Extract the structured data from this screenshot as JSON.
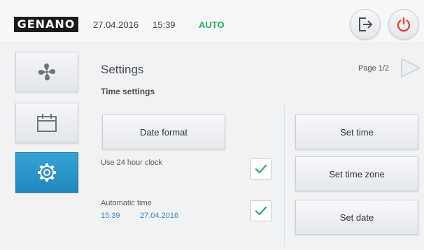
{
  "header": {
    "logo_text": "GENANO",
    "date": "27.04.2016",
    "time": "15:39",
    "mode": "AUTO",
    "mode_color": "#27b05a",
    "logout_icon": "logout-icon",
    "power_icon": "power-icon",
    "power_color": "#e0483f"
  },
  "sidebar": {
    "items": [
      {
        "icon": "fan-icon",
        "active": false
      },
      {
        "icon": "calendar-icon",
        "active": false
      },
      {
        "icon": "gear-icon",
        "active": true
      }
    ],
    "active_color": "#2b97cb"
  },
  "main": {
    "title": "Settings",
    "section_title": "Time settings",
    "page_indicator": "Page 1/2",
    "next_icon": "next-page-icon",
    "date_format_label": "Date format",
    "use_24h_label": "Use 24 hour clock",
    "use_24h_checked": true,
    "automatic_time_label": "Automatic time",
    "automatic_time_checked": true,
    "auto_time_value": "15:39",
    "auto_date_value": "27.04.2016",
    "set_time_label": "Set time",
    "set_time_zone_label": "Set time zone",
    "set_date_label": "Set date",
    "check_color": "#2fb36a"
  }
}
